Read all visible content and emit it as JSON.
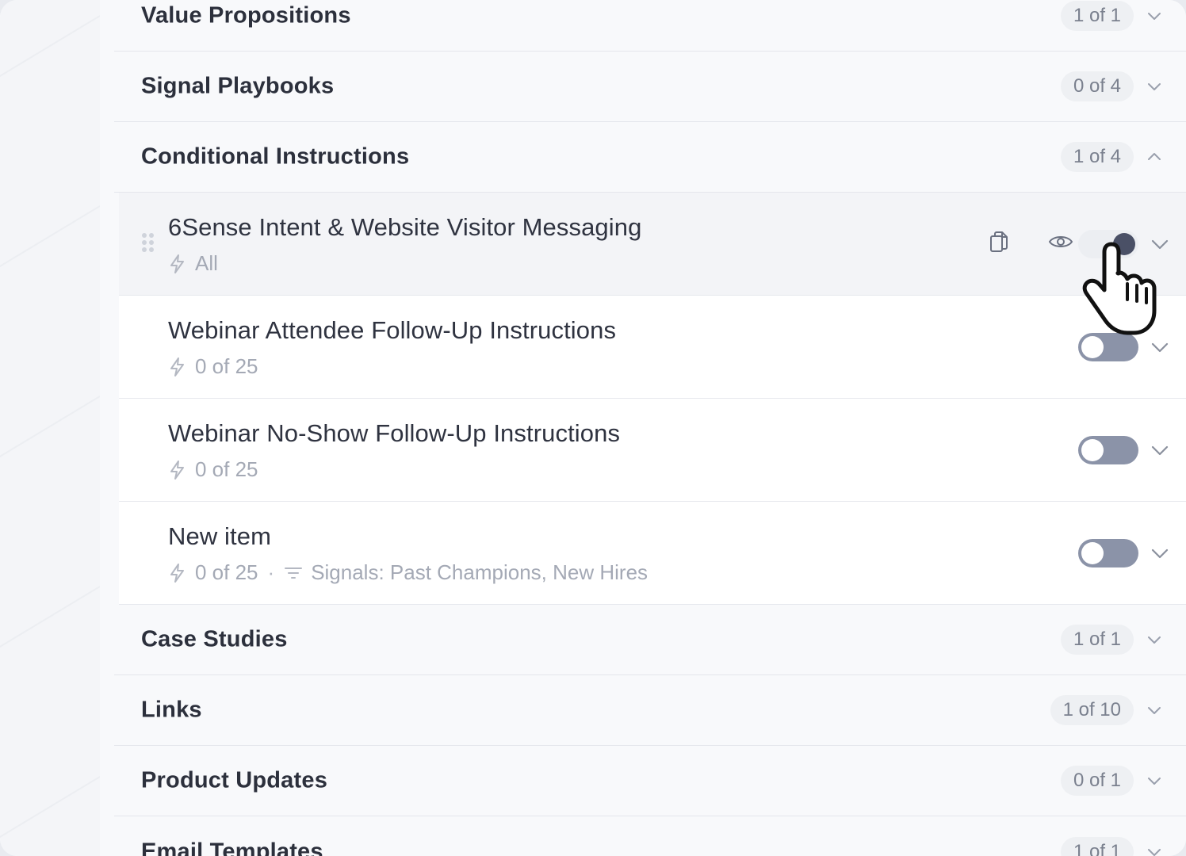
{
  "sections_top": [
    {
      "title": "Value Propositions",
      "count": "1 of 1",
      "expanded": false
    },
    {
      "title": "Signal Playbooks",
      "count": "0 of 4",
      "expanded": false
    },
    {
      "title": "Conditional Instructions",
      "count": "1 of 4",
      "expanded": true
    }
  ],
  "items": [
    {
      "title": "6Sense Intent & Website Visitor Messaging",
      "meta": "All",
      "signals": "",
      "enabled": true,
      "hovered": true
    },
    {
      "title": "Webinar Attendee Follow-Up Instructions",
      "meta": "0 of 25",
      "signals": "",
      "enabled": false,
      "hovered": false
    },
    {
      "title": "Webinar No-Show Follow-Up Instructions",
      "meta": "0 of 25",
      "signals": "",
      "enabled": false,
      "hovered": false
    },
    {
      "title": "New item",
      "meta": "0 of 25",
      "signals": "Signals: Past Champions, New Hires",
      "enabled": false,
      "hovered": false
    }
  ],
  "sections_bottom": [
    {
      "title": "Case Studies",
      "count": "1 of 1",
      "expanded": false
    },
    {
      "title": "Links",
      "count": "1 of 10",
      "expanded": false
    },
    {
      "title": "Product Updates",
      "count": "0 of 1",
      "expanded": false
    },
    {
      "title": "Email Templates",
      "count": "1 of 1",
      "expanded": false
    }
  ],
  "icons": {
    "copy": "copy-icon",
    "preview": "eye-icon",
    "drag": "drag-handle-icon",
    "bolt": "lightning-icon",
    "filter": "filter-icon",
    "cursor": "hand-pointer-cursor"
  },
  "colors": {
    "toggle_off": "#8b93a8",
    "toggle_on_track": "#eceef2",
    "text_primary": "#2c303c",
    "text_muted": "#a4a9b5"
  }
}
